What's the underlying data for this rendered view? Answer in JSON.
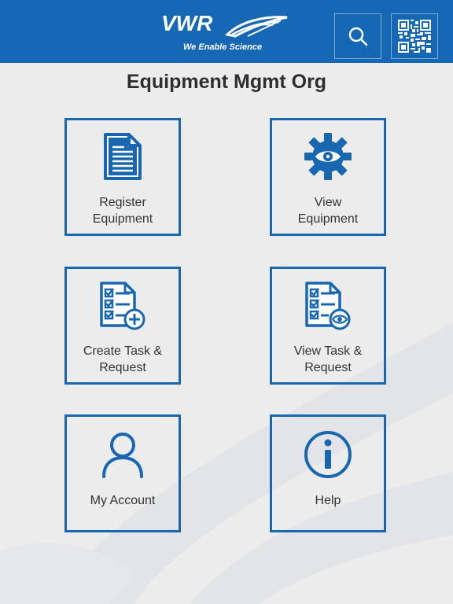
{
  "header": {
    "brand": "VWR",
    "tagline": "We Enable Science",
    "search_icon": "search-icon",
    "qr_icon": "qr-code-icon",
    "color": "#1668b4"
  },
  "page_title": "Equipment Mgmt Org",
  "tiles": [
    {
      "line1": "Register",
      "line2": "Equipment",
      "icon": "document-icon"
    },
    {
      "line1": "View",
      "line2": "Equipment",
      "icon": "gear-eye-icon"
    },
    {
      "line1": "Create Task &",
      "line2": "Request",
      "icon": "checklist-add-icon"
    },
    {
      "line1": "View Task &",
      "line2": "Request",
      "icon": "checklist-view-icon"
    },
    {
      "line1": "My Account",
      "icon": "user-icon"
    },
    {
      "line1": "Help",
      "icon": "info-icon"
    }
  ],
  "colors": {
    "accent": "#1a67b1",
    "background": "#ececec"
  }
}
